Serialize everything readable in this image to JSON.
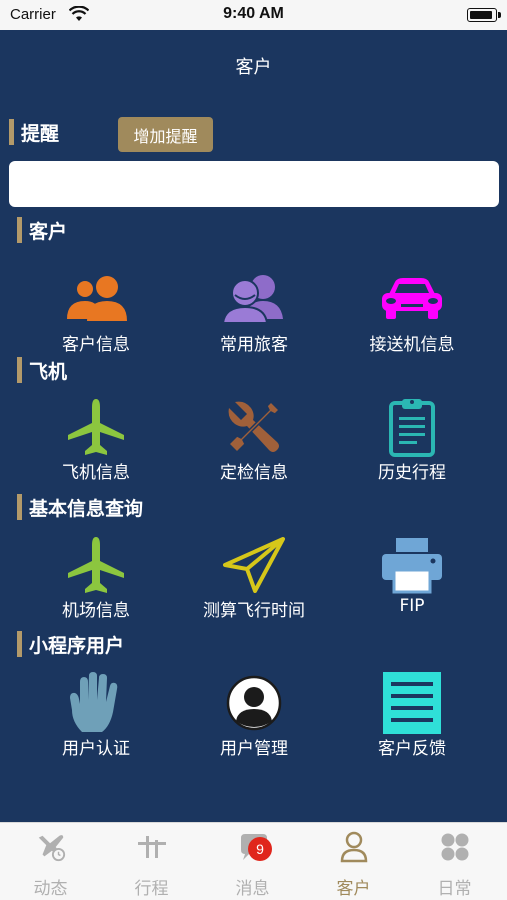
{
  "status_bar": {
    "carrier": "Carrier",
    "time": "9:40 AM",
    "battery_level": 0.95
  },
  "nav": {
    "title": "客户"
  },
  "reminder": {
    "header": "提醒",
    "add_button": "增加提醒",
    "input_value": ""
  },
  "sections": [
    {
      "header": "客户",
      "items": [
        {
          "label": "客户信息",
          "icon": "customers-icon",
          "color": "#e87722"
        },
        {
          "label": "常用旅客",
          "icon": "frequent-travelers-icon",
          "color": "#8e6cc9"
        },
        {
          "label": "接送机信息",
          "icon": "car-icon",
          "color": "#ff00ff"
        }
      ]
    },
    {
      "header": "飞机",
      "items": [
        {
          "label": "飞机信息",
          "icon": "airplane-icon",
          "color": "#8cc63f"
        },
        {
          "label": "定检信息",
          "icon": "tools-icon",
          "color": "#a0603a"
        },
        {
          "label": "历史行程",
          "icon": "clipboard-icon",
          "color": "#2bb7b3"
        }
      ]
    },
    {
      "header": "基本信息查询",
      "items": [
        {
          "label": "机场信息",
          "icon": "airport-airplane-icon",
          "color": "#8cc63f"
        },
        {
          "label": "测算飞行时间",
          "icon": "paper-plane-icon",
          "color": "#d6c71a"
        },
        {
          "label": "FIP",
          "icon": "printer-icon",
          "color": "#6fa6d6"
        }
      ]
    },
    {
      "header": "小程序用户",
      "items": [
        {
          "label": "用户认证",
          "icon": "hand-icon",
          "color": "#6fa0b8"
        },
        {
          "label": "用户管理",
          "icon": "user-avatar-icon",
          "color": "#ffffff"
        },
        {
          "label": "客户反馈",
          "icon": "document-icon",
          "color": "#2fe0d8"
        }
      ]
    }
  ],
  "tabs": [
    {
      "label": "动态",
      "icon": "flight-status-icon",
      "active": false
    },
    {
      "label": "行程",
      "icon": "itinerary-icon",
      "active": false
    },
    {
      "label": "消息",
      "icon": "message-icon",
      "active": false,
      "badge": "9"
    },
    {
      "label": "客户",
      "icon": "person-icon",
      "active": true
    },
    {
      "label": "日常",
      "icon": "daily-icon",
      "active": false
    }
  ],
  "colors": {
    "background": "#1b365f",
    "accent": "#a08a5c",
    "badge": "#e0261c",
    "tab_inactive": "#b0b0b0"
  }
}
